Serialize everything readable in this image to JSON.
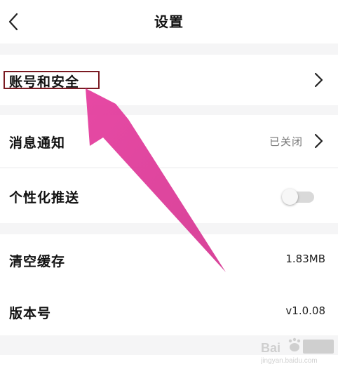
{
  "header": {
    "title": "设置",
    "back_icon": "chevron-left-icon"
  },
  "settings": {
    "account_security": {
      "label": "账号和安全",
      "icon": "chevron-right-icon"
    },
    "notifications": {
      "label": "消息通知",
      "value": "已关闭",
      "icon": "chevron-right-icon"
    },
    "personalized_push": {
      "label": "个性化推送",
      "toggle_on": false
    },
    "clear_cache": {
      "label": "清空缓存",
      "value": "1.83MB"
    },
    "version": {
      "label": "版本号",
      "value": "v1.0.08"
    }
  },
  "overlay": {
    "highlight_color": "#7a1a22",
    "arrow_color": "#e040a0"
  },
  "colors": {
    "background": "#f5f5f6",
    "card": "#ffffff",
    "text": "#111111",
    "muted_text": "#777777"
  }
}
